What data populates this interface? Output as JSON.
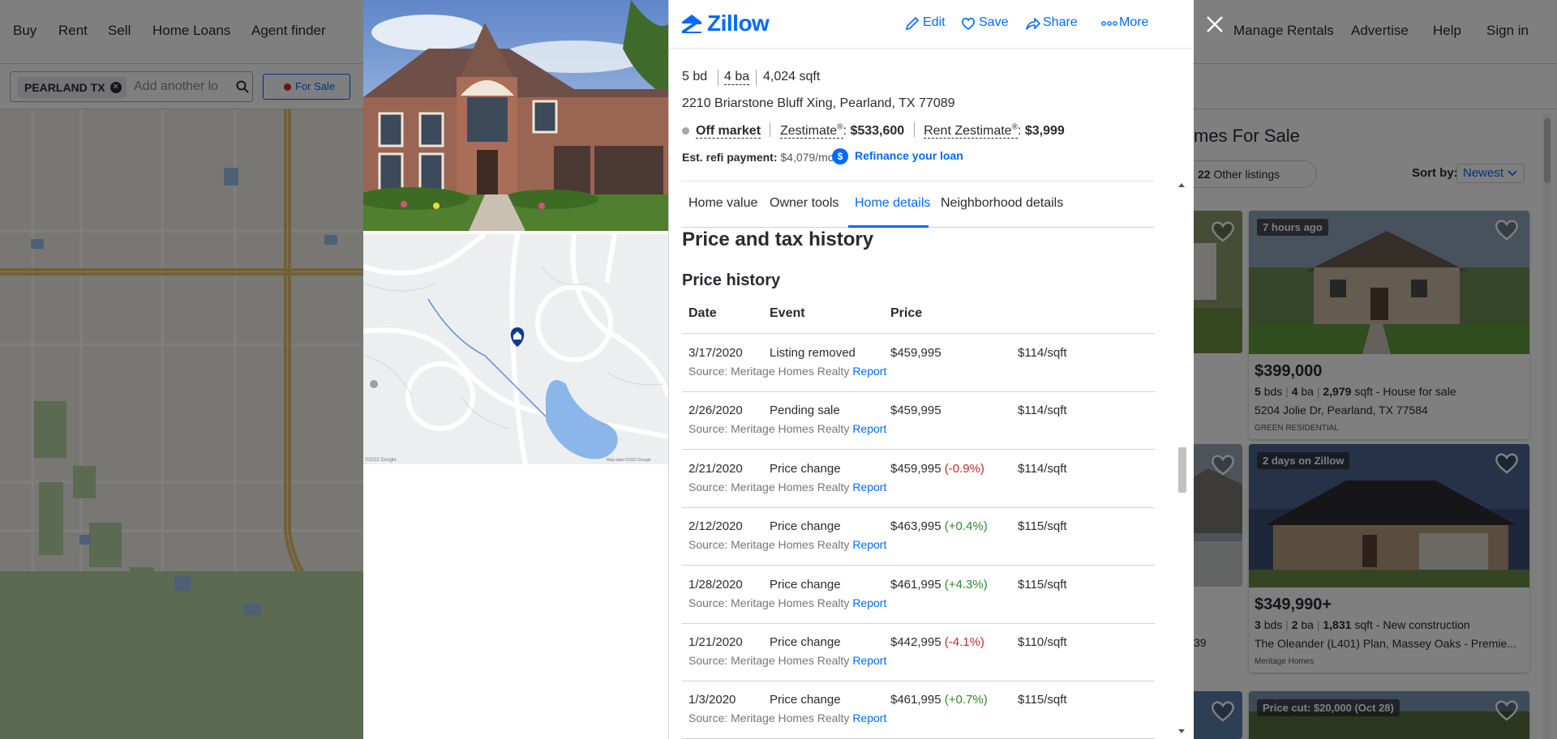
{
  "nav": {
    "left": [
      "Buy",
      "Rent",
      "Sell",
      "Home Loans",
      "Agent finder"
    ],
    "right": [
      "Manage Rentals",
      "Advertise",
      "Help",
      "Sign in"
    ]
  },
  "search": {
    "chip": "PEARLAND TX",
    "placeholder": "Add another location",
    "visible_placeholder": "Add another lo",
    "for_sale": "For Sale"
  },
  "listings": {
    "heading": "mes For Sale",
    "other_count": "22",
    "other_label": "Other listings",
    "sort_label": "Sort by:",
    "sort_value": "Newest",
    "partial_text": "39",
    "cards": [
      {
        "badge": "7 hours ago",
        "price": "$399,000",
        "beds": "5",
        "beds_label": "bds",
        "baths": "4",
        "baths_label": "ba",
        "sqft": "2,979",
        "sqft_label": "sqft",
        "type": "- House for sale",
        "address": "5204 Jolie Dr, Pearland, TX 77584",
        "broker": "GREEN RESIDENTIAL"
      },
      {
        "badge": "2 days on Zillow",
        "price": "$349,990+",
        "beds": "3",
        "beds_label": "bds",
        "baths": "2",
        "baths_label": "ba",
        "sqft": "1,831",
        "sqft_label": "sqft",
        "type": "- New construction",
        "address": "The Oleander (L401) Plan, Massey Oaks - Premie...",
        "broker": "Meritage Homes"
      },
      {
        "badge": "Price cut: $20,000 (Oct 28)"
      }
    ]
  },
  "modal": {
    "logo": "Zillow",
    "actions": [
      "Edit",
      "Save",
      "Share",
      "More"
    ],
    "beds": "5 bd",
    "baths": "4 ba",
    "sqft": "4,024 sqft",
    "address": "2210 Briarstone Bluff Xing, Pearland, TX 77089",
    "status": "Off market",
    "zestimate_label": "Zestimate",
    "zestimate_value": "$533,600",
    "rent_label": "Rent Zestimate",
    "rent_value": "$3,999",
    "refi_label": "Est. refi payment:",
    "refi_value": "$4,079/mo",
    "refi_link": "Refinance your loan",
    "tabs": [
      "Home value",
      "Owner tools",
      "Home details",
      "Neighborhood details"
    ],
    "active_tab": "Home details",
    "section_title": "Price and tax history",
    "sub_title": "Price history",
    "table_headers": [
      "Date",
      "Event",
      "Price"
    ],
    "report_label": "Report",
    "rows": [
      {
        "date": "3/17/2020",
        "event": "Listing removed",
        "price": "$459,995",
        "change": "",
        "ppsf": "$114/sqft",
        "source": "Source: Meritage Homes Realty"
      },
      {
        "date": "2/26/2020",
        "event": "Pending sale",
        "price": "$459,995",
        "change": "",
        "ppsf": "$114/sqft",
        "source": "Source: Meritage Homes Realty"
      },
      {
        "date": "2/21/2020",
        "event": "Price change",
        "price": "$459,995",
        "change": "(-0.9%)",
        "ppsf": "$114/sqft",
        "source": "Source: Meritage Homes Realty"
      },
      {
        "date": "2/12/2020",
        "event": "Price change",
        "price": "$463,995",
        "change": "(+0.4%)",
        "ppsf": "$115/sqft",
        "source": "Source: Meritage Homes Realty"
      },
      {
        "date": "1/28/2020",
        "event": "Price change",
        "price": "$461,995",
        "change": "(+4.3%)",
        "ppsf": "$115/sqft",
        "source": "Source: Meritage Homes Realty"
      },
      {
        "date": "1/21/2020",
        "event": "Price change",
        "price": "$442,995",
        "change": "(-4.1%)",
        "ppsf": "$110/sqft",
        "source": "Source: Meritage Homes Realty"
      },
      {
        "date": "1/3/2020",
        "event": "Price change",
        "price": "$461,995",
        "change": "(+0.7%)",
        "ppsf": "$115/sqft",
        "source": "Source: Meritage Homes Realty"
      }
    ],
    "map_credit_left": "©2022 Google",
    "map_credit_right": "Map data ©2022 Google"
  },
  "colors": {
    "accent": "#006aff",
    "negative": "#c62828",
    "positive": "#2c8a2c",
    "text": "#2a2a33"
  }
}
